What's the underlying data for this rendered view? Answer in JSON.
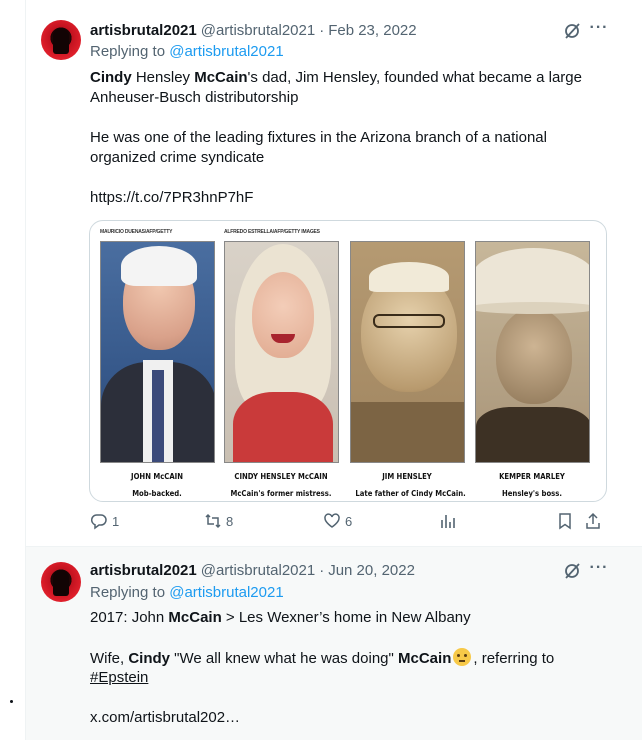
{
  "tweets": [
    {
      "display_name": "artisbrutal2021",
      "handle": "@artisbrutal2021",
      "separator": "·",
      "date": "Feb 23, 2022",
      "more": "···",
      "replying_prefix": "Replying to ",
      "replying_handle": "@artisbrutal2021",
      "line1": {
        "a": "Cindy",
        "b": " Hensley ",
        "c": "McCain",
        "d": "'s dad, Jim Hensley, founded what became a large"
      },
      "line2": "Anheuser-Busch distributorship",
      "line3": "He was one of the leading fixtures in the Arizona branch of a national",
      "line4": "organized crime syndicate",
      "link": "https://t.co/7PR3hnP7hF",
      "media": {
        "credits": [
          "MAURICIO DUENAS/AFP/GETTY",
          "ALFREDO ESTRELLA/AFP/GETTY IMAGES"
        ],
        "captions": [
          {
            "name": "JOHN McCAIN",
            "sub": "Mob-backed."
          },
          {
            "name": "CINDY HENSLEY McCAIN",
            "sub": "McCain's former mistress."
          },
          {
            "name": "JIM HENSLEY",
            "sub": "Late father of Cindy McCain."
          },
          {
            "name": "KEMPER MARLEY",
            "sub": "Hensley's boss."
          }
        ]
      },
      "actions": {
        "replies": "1",
        "reposts": "8",
        "likes": "6"
      }
    },
    {
      "display_name": "artisbrutal2021",
      "handle": "@artisbrutal2021",
      "separator": "·",
      "date": "Jun 20, 2022",
      "more": "···",
      "replying_prefix": "Replying to ",
      "replying_handle": "@artisbrutal2021",
      "line1": {
        "a": "2017: John ",
        "b": "McCain",
        "c": " > Les Wexner’s home in New Albany"
      },
      "line2": {
        "a": "Wife, ",
        "b": "Cindy",
        "c": " \"We all knew what he was doing\" ",
        "d": "McCain",
        "e": ", referring to"
      },
      "line3": "#Epstein",
      "line4": "x.com/artisbrutal202…"
    }
  ],
  "icons": {
    "grok": "grok-icon",
    "more": "more-icon",
    "reply": "reply-icon",
    "repost": "repost-icon",
    "like": "heart-icon",
    "views": "views-icon",
    "bookmark": "bookmark-icon",
    "share": "share-icon",
    "emoji": "rolling-eyes-emoji"
  },
  "colors": {
    "link": "#1d9bf0",
    "secondary_text": "#536471",
    "text": "#0f1419"
  }
}
